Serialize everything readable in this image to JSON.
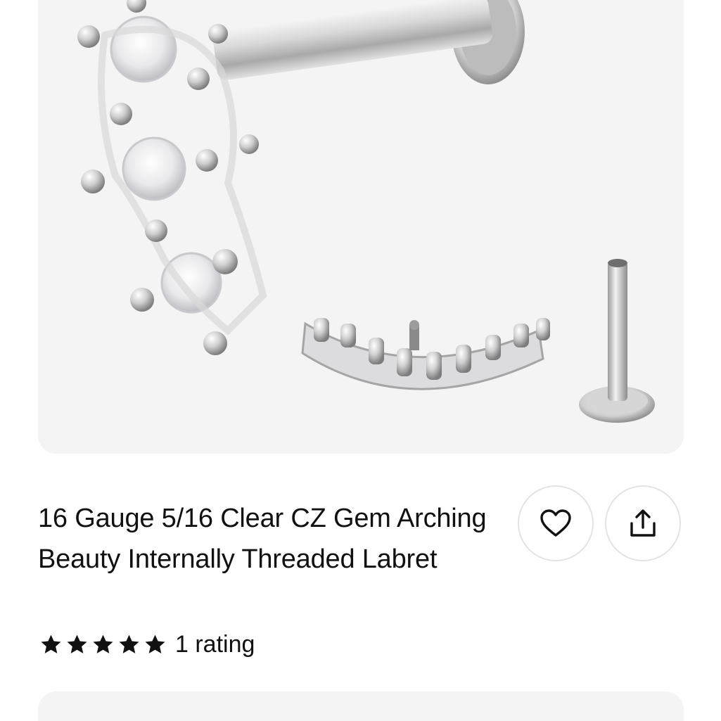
{
  "product": {
    "title": "16 Gauge 5/16 Clear CZ Gem Arching Beauty Internally Threaded Labret",
    "rating": {
      "stars": 5,
      "max_stars": 5,
      "count_label": "1 rating"
    },
    "image_alt_icon": "product-photo"
  },
  "actions": {
    "favorite_icon": "heart-icon",
    "share_icon": "share-icon"
  },
  "colors": {
    "card_background": "#f4f4f5",
    "text": "#111111",
    "button_border": "#e3e3e5"
  }
}
